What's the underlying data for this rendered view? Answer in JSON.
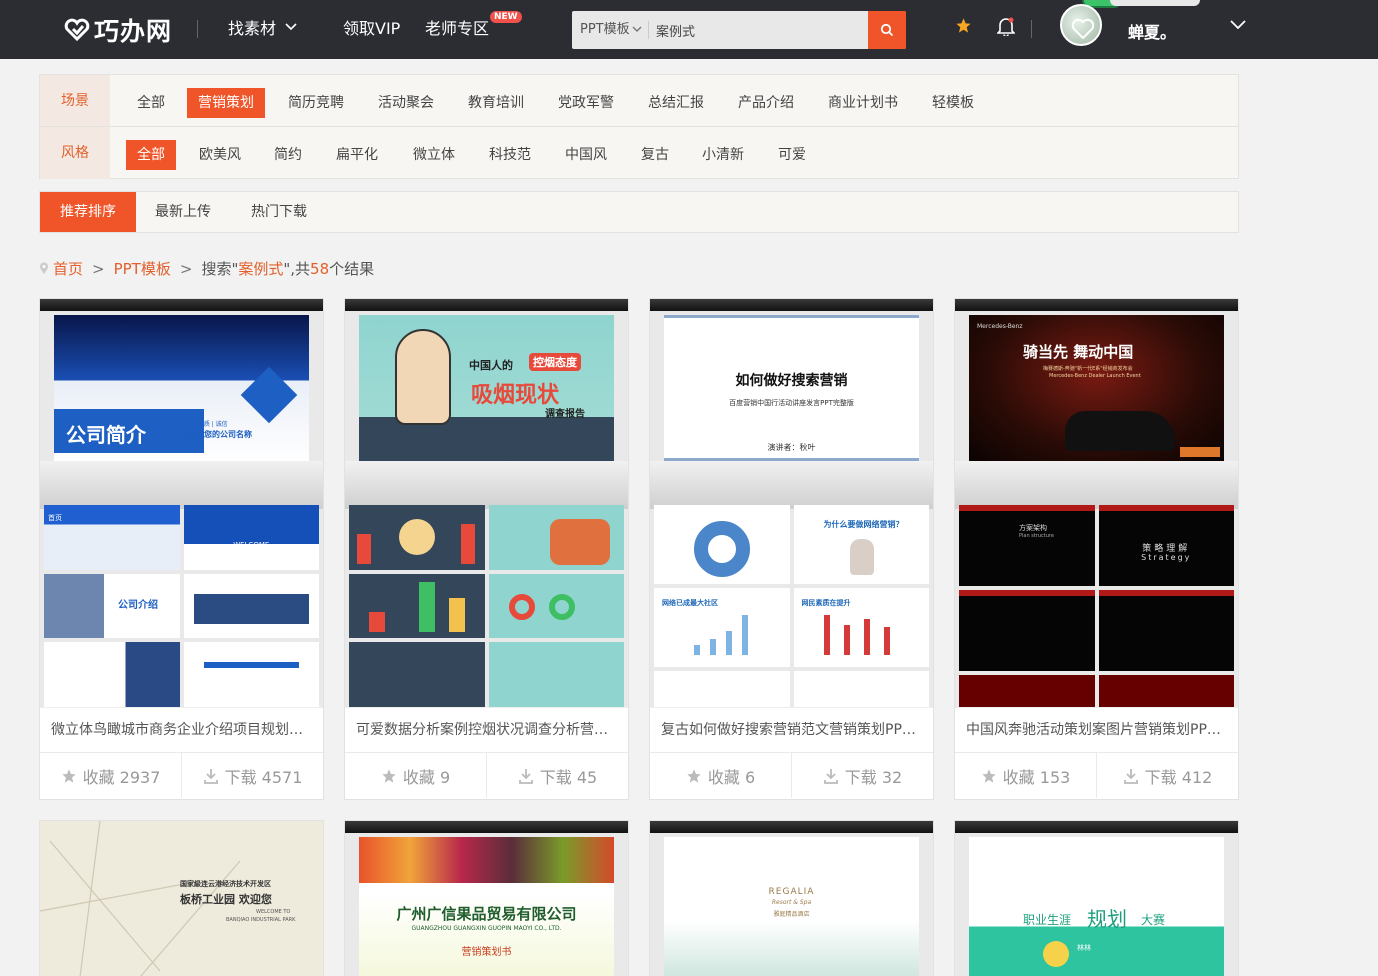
{
  "header": {
    "logo_text": "巧办网",
    "nav": {
      "materials": "找素材",
      "vip": "领取VIP",
      "teacher": "老师专区",
      "new_badge": "NEW"
    },
    "search": {
      "category": "PPT模板",
      "query": "案例式"
    },
    "username": "蝉夏。"
  },
  "filters": {
    "scene_label": "场景",
    "scene_options": [
      "全部",
      "营销策划",
      "简历竞聘",
      "活动聚会",
      "教育培训",
      "党政军警",
      "总结汇报",
      "产品介绍",
      "商业计划书",
      "轻模板"
    ],
    "scene_active": "营销策划",
    "style_label": "风格",
    "style_options": [
      "全部",
      "欧美风",
      "简约",
      "扁平化",
      "微立体",
      "科技范",
      "中国风",
      "复古",
      "小清新",
      "可爱"
    ],
    "style_active": "全部"
  },
  "sort": {
    "recommended": "推荐排序",
    "latest": "最新上传",
    "hot": "热门下载"
  },
  "breadcrumb": {
    "home": "首页",
    "sep": ">",
    "category": "PPT模板",
    "search_prefix": "搜索\"",
    "keyword": "案例式",
    "search_mid": "\",共",
    "count": "58",
    "search_suffix": "个结果"
  },
  "cards": [
    {
      "title": "微立体鸟瞰城市商务企业介绍项目规划营...",
      "fav": "收藏 2937",
      "dl": "下载 4571",
      "cover_title": "公司简介",
      "cover_sub": "请添加您的公司名称",
      "cover_tag": "专注 | 品质 | 诚信",
      "thumb_labels": [
        "首页",
        "WELCOME",
        "公司介绍"
      ]
    },
    {
      "title": "可爱数据分析案例控烟状况调查分析营销...",
      "fav": "收藏 9",
      "dl": "下载 45",
      "cover_a": "中国人的",
      "cover_b": "控烟态度",
      "cover_c": "吸烟现状",
      "cover_d": "调查报告"
    },
    {
      "title": "复古如何做好搜索营销范文营销策划PPT...",
      "fav": "收藏 6",
      "dl": "下载 32",
      "cover_title": "如何做好搜索营销",
      "cover_sub": "百度营销中国行活动讲座发言PPT完整版",
      "cover_speaker": "演讲者：秋叶",
      "thumb_labels": [
        "为什么要做网络营销？",
        "网络已成最大社区",
        "网民素质在提升"
      ]
    },
    {
      "title": "中国风奔驰活动策划案图片营销策划PPT...",
      "fav": "收藏 153",
      "dl": "下载 412",
      "cover_brand": "Mercedes-Benz",
      "cover_title": "骑当先  舞动中国",
      "cover_sub": "梅赛德斯-奔驰\"新一代E系\"经销商发布会",
      "cover_sub2": "Mercedes-Benz Dealer Launch Event",
      "thumb_labels": [
        "方案架构",
        "Plan structure",
        "策略理解",
        "Strategy"
      ]
    },
    {
      "cover_a": "国家級连云港经济技术开发区",
      "cover_b": "板桥工业园    欢迎您",
      "cover_c": "WELCOME TO",
      "cover_d": "BANQIAO INDUSTRIAL PARK"
    },
    {
      "cover_title": "广州广信果品贸易有限公司",
      "cover_sub": "GUANGZHOU GUANGXIN GUOPIN MAOYI CO., LTD.",
      "cover_tag": "营销策划书"
    },
    {
      "cover_brand": "REGALIA",
      "cover_sub": "Resort & Spa",
      "cover_cn": "雅庭精品酒店"
    },
    {
      "cover_a": "职业生涯",
      "cover_b": "规划",
      "cover_c": "大赛",
      "cover_name": "林林"
    }
  ]
}
